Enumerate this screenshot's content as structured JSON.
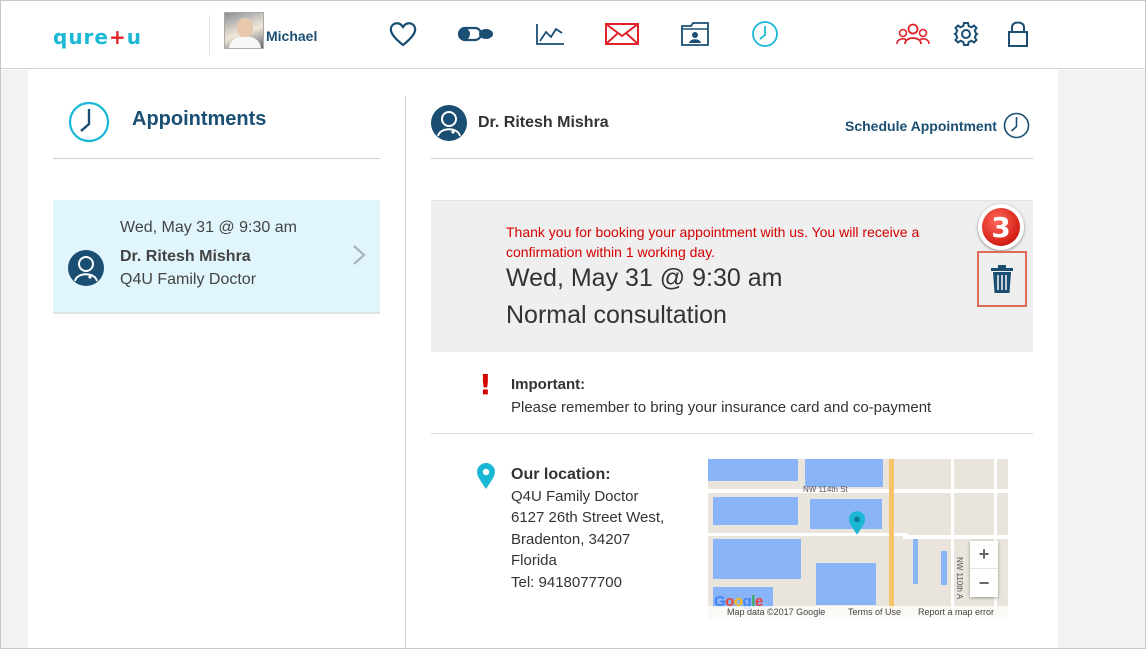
{
  "header": {
    "logo": {
      "left": "qure",
      "plus": "+",
      "right": "u"
    },
    "user_name": "Michael",
    "nav": [
      {
        "name": "heart-icon"
      },
      {
        "name": "pills-icon"
      },
      {
        "name": "chart-icon"
      },
      {
        "name": "mail-icon"
      },
      {
        "name": "folder-icon"
      },
      {
        "name": "clock-icon"
      },
      {
        "name": "users-icon"
      },
      {
        "name": "gear-icon"
      },
      {
        "name": "lock-icon"
      }
    ],
    "colors": {
      "teal": "#1bb8d6",
      "navy": "#1a4f73",
      "red": "#e0232a"
    }
  },
  "sidebar": {
    "title": "Appointments",
    "items": [
      {
        "date": "Wed, May 31 @ 9:30 am",
        "doctor": "Dr. Ritesh Mishra",
        "place": "Q4U Family Doctor"
      }
    ]
  },
  "detail": {
    "doctor": "Dr. Ritesh Mishra",
    "schedule_label": "Schedule Appointment",
    "thanks_message": "Thank you for booking your appointment with us. You will receive a confirmation within 1 working day.",
    "date_time": "Wed, May 31 @ 9:30 am",
    "type": "Normal consultation",
    "step_badge": "3",
    "important_label": "Important:",
    "important_text": "Please remember to bring your insurance card and co-payment",
    "location": {
      "label": "Our location:",
      "name": "Q4U Family Doctor",
      "street": "6127 26th Street West,",
      "city": "Bradenton, 34207",
      "state": "Florida",
      "phone": "Tel: 9418077700"
    }
  },
  "map": {
    "street_label": "NW 114th St",
    "vertical_label": "NW 110th A",
    "zoom_in": "+",
    "zoom_out": "−",
    "google": "Google",
    "attribution": "Map data ©2017 Google",
    "terms": "Terms of Use",
    "report": "Report a map error"
  }
}
